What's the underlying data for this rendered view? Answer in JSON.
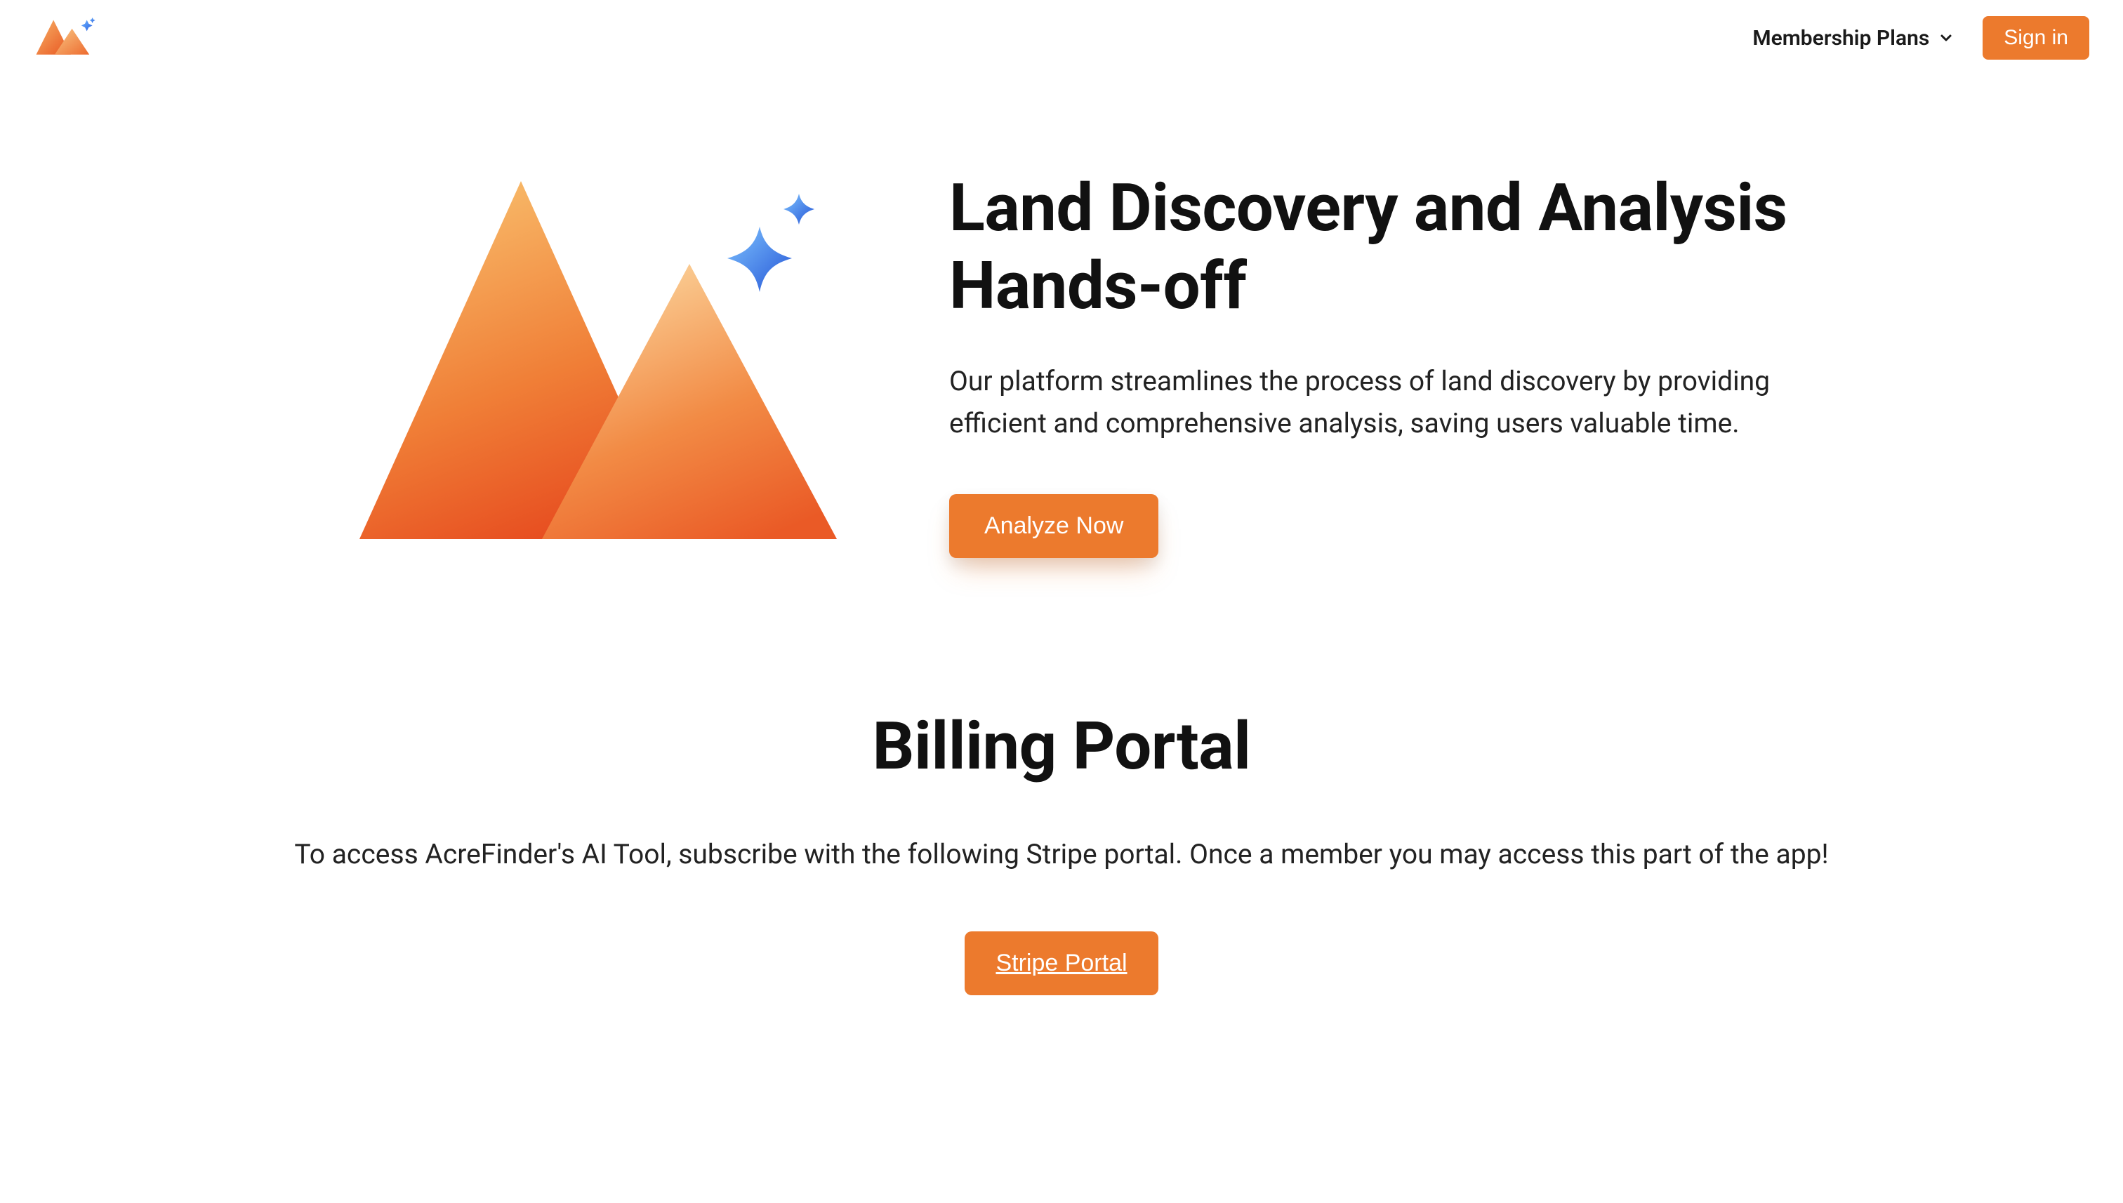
{
  "header": {
    "nav": {
      "membership_label": "Membership Plans"
    },
    "signin_label": "Sign in"
  },
  "hero": {
    "title": "Land Discovery and Analysis Hands-off",
    "subtitle": "Our platform streamlines the process of land discovery by providing efficient and comprehensive analysis, saving users valuable time.",
    "cta_label": "Analyze Now"
  },
  "billing": {
    "title": "Billing Portal",
    "subtitle": "To access AcreFinder's AI Tool, subscribe with the following Stripe portal. Once a member you may access this part of the app!",
    "cta_label": "Stripe Portal"
  },
  "colors": {
    "accent": "#ec7a2d"
  }
}
